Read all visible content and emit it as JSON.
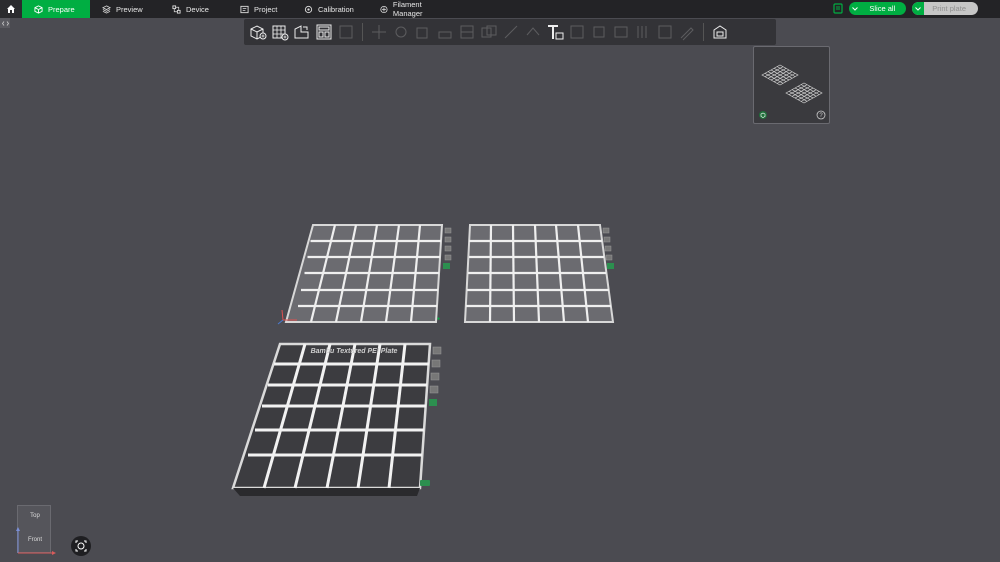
{
  "topbar": {
    "tabs": [
      {
        "label": "Prepare",
        "icon": "cube-icon",
        "active": true
      },
      {
        "label": "Preview",
        "icon": "layers-icon"
      },
      {
        "label": "Device",
        "icon": "device-icon"
      },
      {
        "label": "Project",
        "icon": "project-icon"
      },
      {
        "label": "Calibration",
        "icon": "calibration-icon"
      },
      {
        "label": "Filament Manager",
        "icon": "plus-circle-icon"
      }
    ],
    "slice_all": "Slice all",
    "print_plate": "Print plate"
  },
  "viewport": {
    "plate3_title": "Bambu Textured PEI Plate"
  },
  "navcube": {
    "top": "Top",
    "front": "Front"
  },
  "colors": {
    "accent": "#00ae42",
    "topbar": "#232326",
    "canvas": "#4b4b51"
  }
}
